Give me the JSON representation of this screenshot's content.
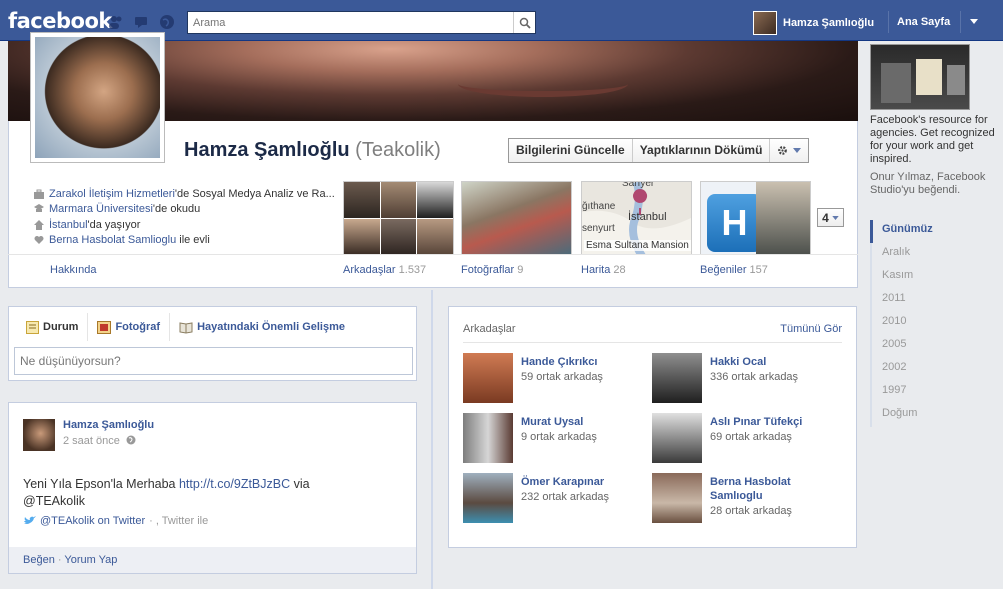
{
  "topbar": {
    "logo": "facebook",
    "search_placeholder": "Arama",
    "user_name": "Hamza Şamlıoğlu",
    "home_label": "Ana Sayfa",
    "brand_color": "#3b5998"
  },
  "profile": {
    "name": "Hamza Şamlıoğlu",
    "nickname": "(Teakolik)",
    "buttons": {
      "update_info": "Bilgilerini Güncelle",
      "activity_log": "Yaptıklarının Dökümü"
    },
    "info": [
      {
        "link": "Zarakol İletişim Hizmetleri",
        "text": "'de Sosyal Medya Analiz ve Ra..."
      },
      {
        "link": "Marmara Üniversitesi",
        "text": "'de okudu"
      },
      {
        "link": "İstanbul",
        "text": "'da yaşıyor"
      },
      {
        "link": "Berna Hasbolat Samlioglu",
        "text": " ile evli"
      }
    ],
    "tabs": [
      {
        "label": "Hakkında",
        "count": ""
      },
      {
        "label": "Arkadaşlar",
        "count": "1.537"
      },
      {
        "label": "Fotoğraflar",
        "count": "9"
      },
      {
        "label": "Harita",
        "count": "28"
      },
      {
        "label": "Beğeniler",
        "count": "157"
      }
    ],
    "map_labels": {
      "top": "Sarıyer",
      "left": "ğıthane",
      "city": "İstanbul",
      "bottom_left": "senyurt",
      "place": "Esma Sultana Mansion"
    },
    "more_count": "4"
  },
  "composer": {
    "tabs": [
      "Durum",
      "Fotoğraf",
      "Hayatındaki Önemli Gelişme"
    ],
    "placeholder": "Ne düşünüyorsun?"
  },
  "post": {
    "author": "Hamza Şamlıoğlu",
    "time": "2 saat önce",
    "text_before": "Yeni Yıla Epson'la Merhaba ",
    "link": "http://t.co/9ZtBJzBC",
    "text_after": " via @TEAkolik",
    "via_link": "@TEAkolik on Twitter",
    "via_text": " · , Twitter ile",
    "like": "Beğen",
    "comment": "Yorum Yap"
  },
  "friends": {
    "title": "Arkadaşlar",
    "see_all": "Tümünü Gör",
    "items": [
      {
        "name": "Hande Çıkrıkcı",
        "mutual": "59 ortak arkadaş"
      },
      {
        "name": "Hakki Ocal",
        "mutual": "336 ortak arkadaş"
      },
      {
        "name": "Murat Uysal",
        "mutual": "9 ortak arkadaş"
      },
      {
        "name": "Aslı Pınar Tüfekçi",
        "mutual": "69 ortak arkadaş"
      },
      {
        "name": "Ömer Karapınar",
        "mutual": "232 ortak arkadaş"
      },
      {
        "name": "Berna Hasbolat Samlıoglu",
        "mutual": "28 ortak arkadaş"
      }
    ]
  },
  "sidebar": {
    "ad_text": "Facebook's resource for agencies. Get recognized for your work and get inspired.",
    "ad_like": "Onur Yılmaz, Facebook Studio'yu beğendi.",
    "years": [
      "Günümüz",
      "Aralık",
      "Kasım",
      "2011",
      "2010",
      "2005",
      "2002",
      "1997",
      "Doğum"
    ]
  }
}
